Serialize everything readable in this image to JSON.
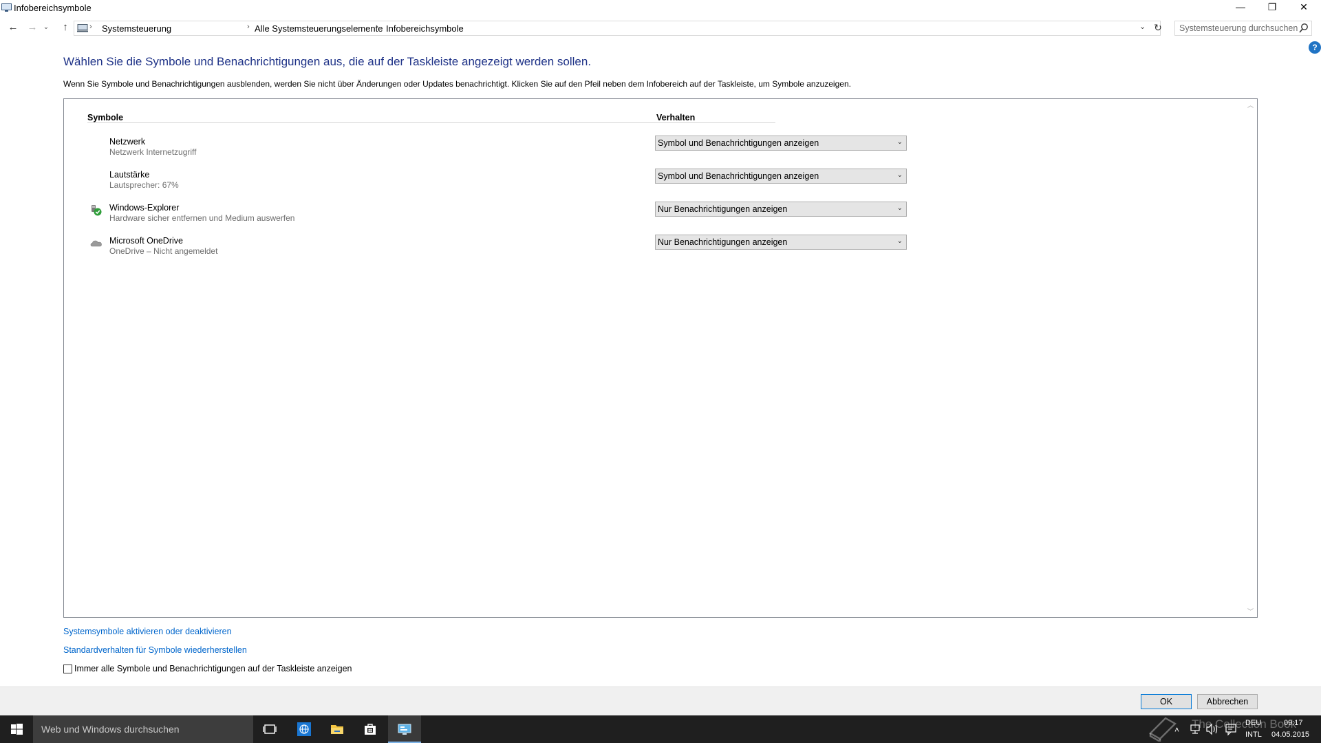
{
  "window": {
    "title": "Infobereichsymbole",
    "controls": {
      "minimize": "—",
      "maximize": "❐",
      "close": "✕"
    }
  },
  "navigation": {
    "back": "←",
    "forward": "→",
    "recent": "⌄",
    "up": "↑",
    "breadcrumbs": [
      "Systemsteuerung",
      "Alle Systemsteuerungselemente",
      "Infobereichsymbole"
    ],
    "separator": "›",
    "dropdown": "⌄",
    "refresh": "↻",
    "search_placeholder": "Systemsteuerung durchsuchen"
  },
  "help": "?",
  "content": {
    "title": "Wählen Sie die Symbole und Benachrichtigungen aus, die auf der Taskleiste angezeigt werden sollen.",
    "description": "Wenn Sie Symbole und Benachrichtigungen ausblenden, werden Sie nicht über Änderungen oder Updates benachrichtigt. Klicken Sie auf den Pfeil neben dem Infobereich auf der Taskleiste, um Symbole anzuzeigen.",
    "columns": {
      "symbols": "Symbole",
      "behavior": "Verhalten"
    },
    "rows": [
      {
        "name": "Netzwerk",
        "subtitle": "Netzwerk Internetzugriff",
        "behavior": "Symbol und Benachrichtigungen anzeigen",
        "icon": "none"
      },
      {
        "name": "Lautstärke",
        "subtitle": "Lautsprecher: 67%",
        "behavior": "Symbol und Benachrichtigungen anzeigen",
        "icon": "none"
      },
      {
        "name": "Windows-Explorer",
        "subtitle": "Hardware sicher entfernen und Medium auswerfen",
        "behavior": "Nur Benachrichtigungen anzeigen",
        "icon": "safely-remove-hardware-icon"
      },
      {
        "name": "Microsoft OneDrive",
        "subtitle": "OneDrive – Nicht angemeldet",
        "behavior": "Nur Benachrichtigungen anzeigen",
        "icon": "onedrive-cloud-icon"
      }
    ],
    "dropdown_arrow": "⌄",
    "scroll_up": "︿",
    "scroll_down": "﹀"
  },
  "links": {
    "system_icons": "Systemsymbole aktivieren oder deaktivieren",
    "restore_defaults": "Standardverhalten für Symbole wiederherstellen"
  },
  "checkbox": {
    "label": "Immer alle Symbole und Benachrichtigungen auf der Taskleiste anzeigen",
    "checked": false
  },
  "buttons": {
    "ok": "OK",
    "cancel": "Abbrechen"
  },
  "taskbar": {
    "search_placeholder": "Web und Windows durchsuchen",
    "language": "DEU",
    "layout": "INTL",
    "time": "09:17",
    "date": "04.05.2015",
    "tray_up": "˄"
  },
  "watermark": "The Collection Book",
  "colors": {
    "title_blue": "#1e3287",
    "link_blue": "#0066cc",
    "taskbar": "#1f1f1f",
    "accent": "#0078d7"
  }
}
